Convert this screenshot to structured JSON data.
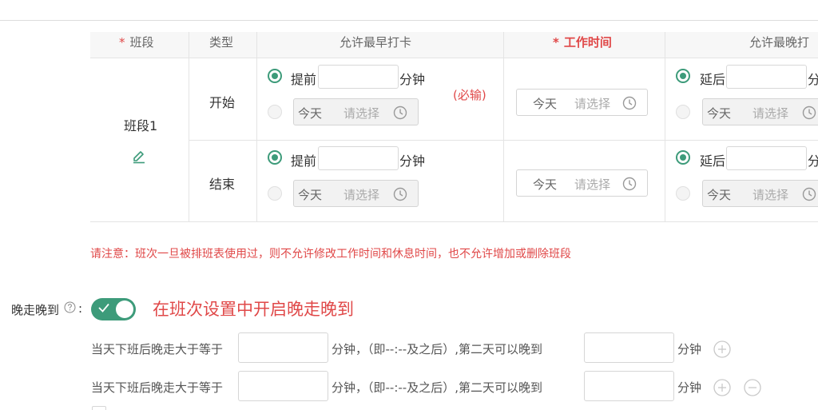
{
  "table": {
    "headers": {
      "segment": "班段",
      "type": "类型",
      "early_clock": "允许最早打卡",
      "work_time": "工作时间",
      "late_clock": "允许最晚打"
    },
    "segment_name": "班段1",
    "rows": [
      {
        "type": "开始",
        "early_label": "提前",
        "early_unit": "分钟",
        "early_value": "",
        "early_picker_day": "今天",
        "early_picker_placeholder": "请选择",
        "work_picker_day": "今天",
        "work_picker_placeholder": "请选择",
        "late_label": "延后",
        "late_unit": "分",
        "late_value": "",
        "late_picker_day": "今天",
        "late_picker_placeholder": "请选择"
      },
      {
        "type": "结束",
        "early_label": "提前",
        "early_unit": "分钟",
        "early_value": "",
        "early_picker_day": "今天",
        "early_picker_placeholder": "请选择",
        "work_picker_day": "今天",
        "work_picker_placeholder": "请选择",
        "late_label": "延后",
        "late_unit": "分",
        "late_value": "",
        "late_picker_day": "今天",
        "late_picker_placeholder": "请选择"
      }
    ],
    "required_note": "(必输)"
  },
  "notice": "请注意：班次一旦被排班表使用过，则不允许修改工作时间和休息时间，也不允许增加或删除班段",
  "late_leave": {
    "label": "晚走晚到",
    "colon": ":",
    "enabled": true,
    "annotation": "在班次设置中开启晚走晚到",
    "rules": [
      {
        "prefix": "当天下班后晚走大于等于",
        "minutes_value": "",
        "middle": "分钟，（即--:--及之后）,第二天可以晚到",
        "late_value": "",
        "suffix": "分钟"
      },
      {
        "prefix": "当天下班后晚走大于等于",
        "minutes_value": "",
        "middle": "分钟，（即--:--及之后）,第二天可以晚到",
        "late_value": "",
        "suffix": "分钟"
      }
    ]
  },
  "colors": {
    "accent": "#3d9b7a",
    "warning": "#e04848"
  },
  "icons": {
    "edit": "pencil-icon",
    "clock": "clock-icon",
    "help": "question-circle-icon",
    "add": "plus-circle-icon",
    "remove": "minus-circle-icon"
  }
}
